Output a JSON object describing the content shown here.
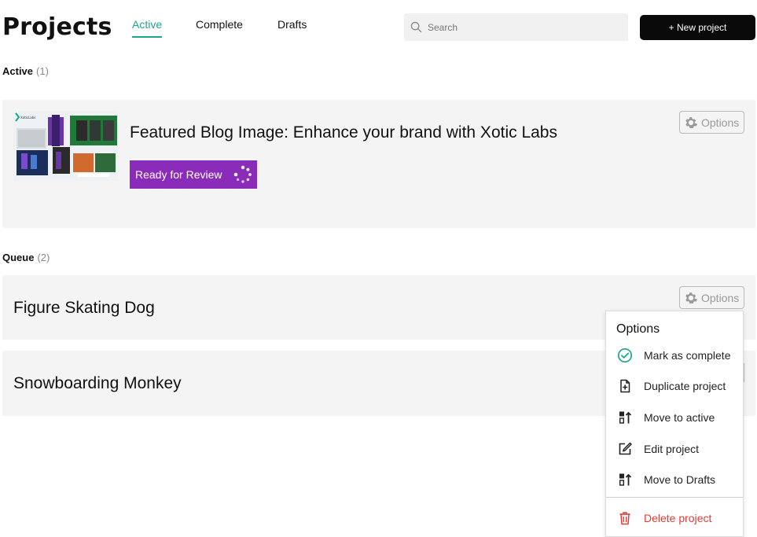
{
  "header": {
    "title": "Projects",
    "tabs": [
      {
        "label": "Active",
        "active": true
      },
      {
        "label": "Complete",
        "active": false
      },
      {
        "label": "Drafts",
        "active": false
      }
    ],
    "search_placeholder": "Search",
    "new_button": "+ New project"
  },
  "sections": {
    "active": {
      "label": "Active",
      "count": "(1)"
    },
    "queue": {
      "label": "Queue",
      "count": "(2)"
    }
  },
  "active_projects": [
    {
      "title": "Featured Blog Image: Enhance your brand with Xotic Labs",
      "status": "Ready for Review",
      "options_label": "Options",
      "thumbnail_brand": "XoticLabs"
    }
  ],
  "queue_projects": [
    {
      "title": "Figure Skating Dog",
      "options_label": "Options"
    },
    {
      "title": "Snowboarding Monkey"
    }
  ],
  "options_menu": {
    "title": "Options",
    "items": [
      {
        "label": "Mark as complete",
        "icon": "check-circle-icon"
      },
      {
        "label": "Duplicate project",
        "icon": "duplicate-icon"
      },
      {
        "label": "Move to active",
        "icon": "move-up-icon"
      },
      {
        "label": "Edit project",
        "icon": "edit-icon"
      },
      {
        "label": "Move to Drafts",
        "icon": "move-up-icon"
      }
    ],
    "delete_label": "Delete project"
  },
  "colors": {
    "accent": "#1aa68a",
    "status_purple": "#8b2bb9",
    "danger": "#e53935",
    "card_bg": "#f4f4f4"
  }
}
